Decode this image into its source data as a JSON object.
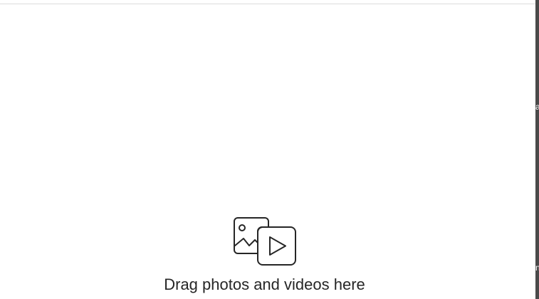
{
  "dropzone": {
    "instruction": "Drag photos and videos here",
    "icon": "photo-video-icon"
  },
  "backdrop": {
    "fragment_1": "a",
    "fragment_2": "ni"
  },
  "colors": {
    "text": "#262626",
    "divider": "#dbdbdb",
    "backdrop": "#4a4a4a"
  }
}
